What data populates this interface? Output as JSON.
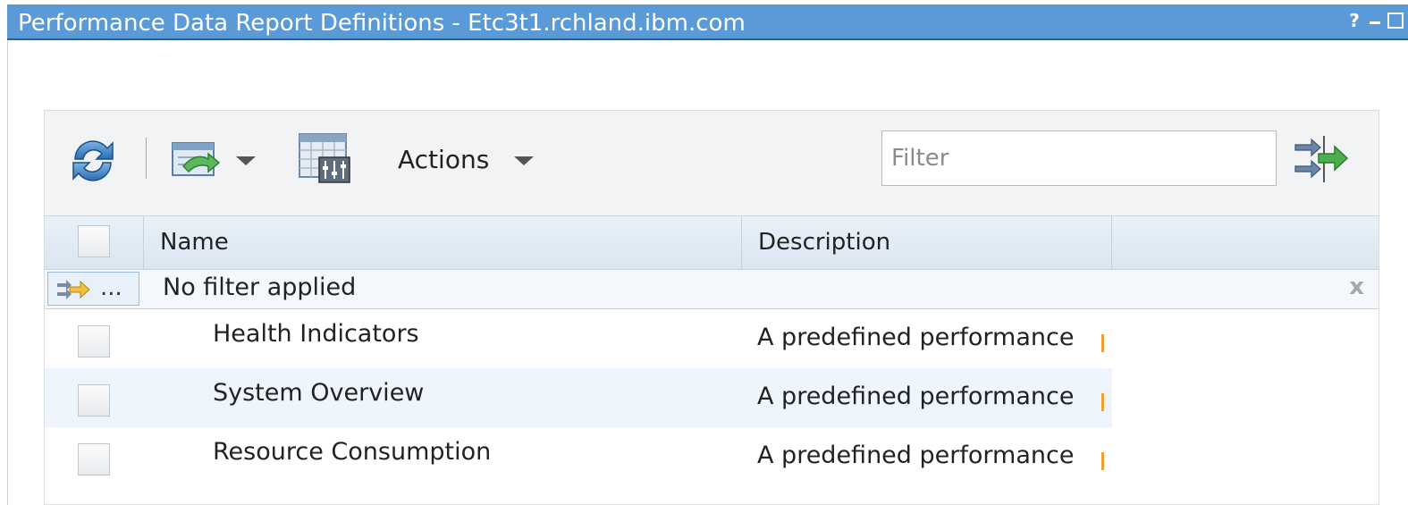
{
  "window": {
    "title": "Performance Data Report Definitions - Etc3t1.rchland.ibm.com",
    "controls": {
      "help": "?",
      "minimize": "minimize-icon",
      "maximize": "maximize-icon"
    }
  },
  "toolbar": {
    "refresh_icon": "refresh-icon",
    "export_icon": "export-icon",
    "columns_icon": "configure-columns-icon",
    "actions_label": "Actions",
    "filter_placeholder": "Filter",
    "advanced_filter_icon": "advanced-filter-icon"
  },
  "table": {
    "columns": [
      "Name",
      "Description"
    ],
    "filter_row": {
      "button_text": "...",
      "status": "No filter applied",
      "clear": "x"
    },
    "rows": [
      {
        "name": "Health Indicators",
        "description": "A predefined performance"
      },
      {
        "name": "System Overview",
        "description": "A predefined performance"
      },
      {
        "name": "Resource Consumption",
        "description": "A predefined performance"
      }
    ]
  },
  "colors": {
    "titlebar": "#5a9ad6",
    "toolbar_bg": "#f2f3f4",
    "header_bg": "#dae6f2",
    "alt_row": "#eef5fc"
  }
}
